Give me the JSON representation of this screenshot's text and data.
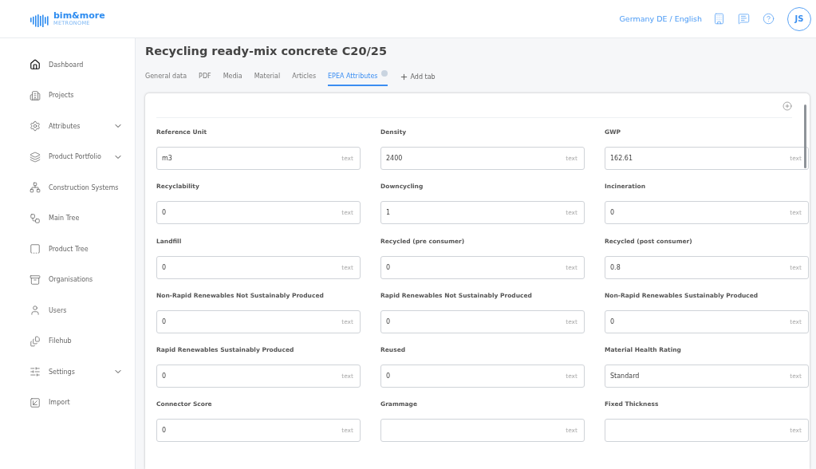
{
  "header": {
    "logo": {
      "name": "bim&more",
      "tagline": "METRONOME"
    },
    "locale": "Germany DE / English",
    "avatar": "JS"
  },
  "sidebar": {
    "items": [
      {
        "label": "Dashboard",
        "expandable": false
      },
      {
        "label": "Projects",
        "expandable": false
      },
      {
        "label": "Attributes",
        "expandable": true
      },
      {
        "label": "Product Portfolio",
        "expandable": true
      },
      {
        "label": "Construction Systems",
        "expandable": false
      },
      {
        "label": "Main Tree",
        "expandable": false
      },
      {
        "label": "Product Tree",
        "expandable": false
      },
      {
        "label": "Organisations",
        "expandable": false
      },
      {
        "label": "Users",
        "expandable": false
      },
      {
        "label": "Filehub",
        "expandable": false
      },
      {
        "label": "Settings",
        "expandable": true
      },
      {
        "label": "Import",
        "expandable": false
      }
    ]
  },
  "page": {
    "title": "Recycling ready-mix concrete C20/25",
    "tabs": [
      {
        "label": "General data",
        "selected": false
      },
      {
        "label": "PDF",
        "selected": false
      },
      {
        "label": "Media",
        "selected": false
      },
      {
        "label": "Material",
        "selected": false
      },
      {
        "label": "Articles",
        "selected": false
      },
      {
        "label": "EPEA Attributes",
        "selected": true,
        "info": true
      }
    ],
    "add_tab": "Add tab",
    "fields": [
      {
        "label": "Reference Unit",
        "value": "m3",
        "type": "text"
      },
      {
        "label": "Density",
        "value": "2400",
        "type": "text"
      },
      {
        "label": "GWP",
        "value": "162.61",
        "type": "text"
      },
      {
        "label": "Recyclability",
        "value": "0",
        "type": "text"
      },
      {
        "label": "Downcycling",
        "value": "1",
        "type": "text"
      },
      {
        "label": "Incineration",
        "value": "0",
        "type": "text"
      },
      {
        "label": "Landfill",
        "value": "0",
        "type": "text"
      },
      {
        "label": "Recycled (pre consumer)",
        "value": "0",
        "type": "text"
      },
      {
        "label": "Recycled (post consumer)",
        "value": "0.8",
        "type": "text"
      },
      {
        "label": "Non-Rapid Renewables Not Sustainably Produced",
        "value": "0",
        "type": "text"
      },
      {
        "label": "Rapid Renewables Not Sustainably Produced",
        "value": "0",
        "type": "text"
      },
      {
        "label": "Non-Rapid Renewables Sustainably Produced",
        "value": "0",
        "type": "text"
      },
      {
        "label": "Rapid Renewables Sustainably Produced",
        "value": "0",
        "type": "text"
      },
      {
        "label": "Reused",
        "value": "0",
        "type": "text"
      },
      {
        "label": "Material Health Rating",
        "value": "Standard",
        "type": "text"
      },
      {
        "label": "Connector Score",
        "value": "0",
        "type": "text"
      },
      {
        "label": "Grammage",
        "type": "text"
      },
      {
        "label": "Fixed Thickness",
        "type": "text"
      }
    ]
  }
}
